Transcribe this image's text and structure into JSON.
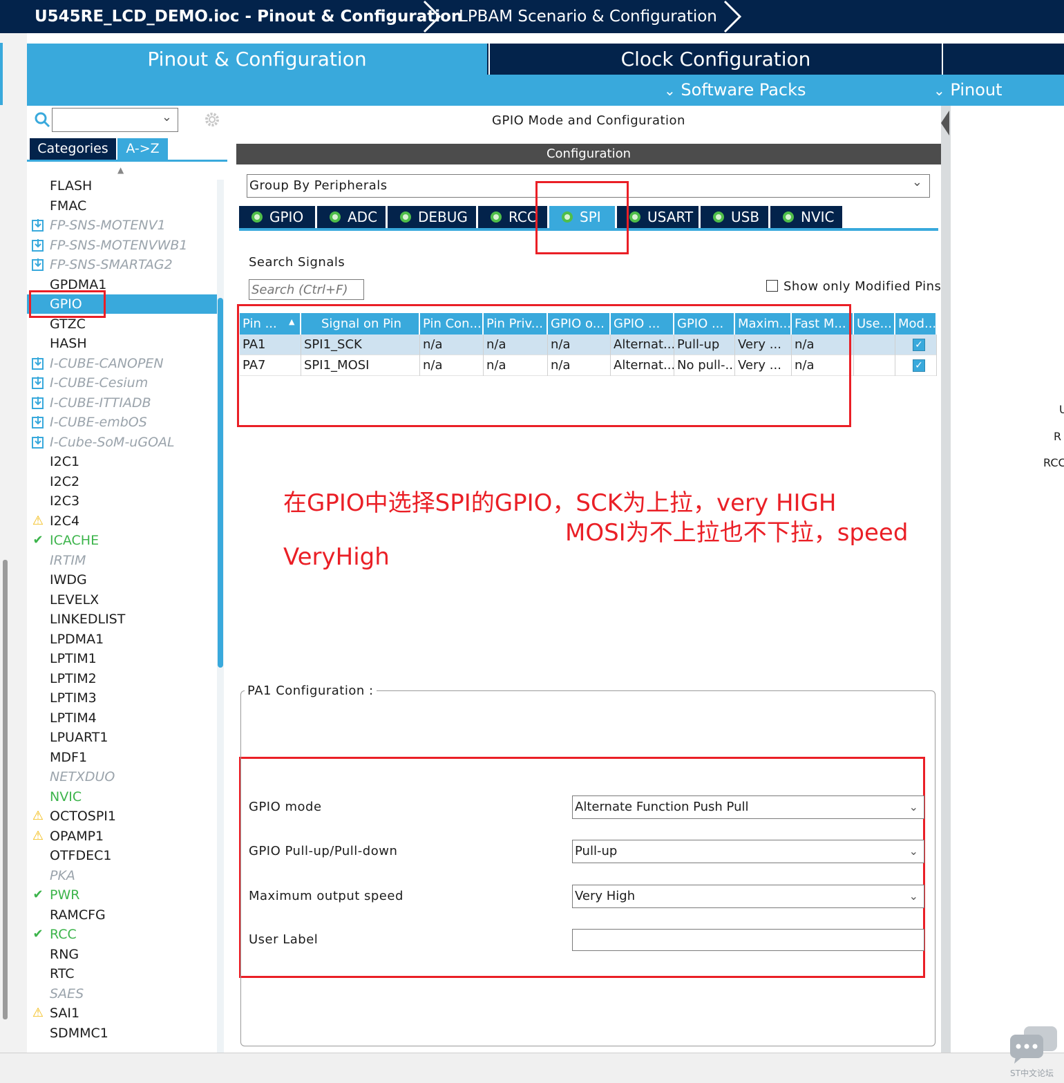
{
  "breadcrumb": {
    "project": "U545RE_LCD_DEMO.ioc - Pinout & Configuration",
    "scenario": "LPBAM Scenario & Configuration"
  },
  "main_tabs": {
    "pinout_config": "Pinout & Configuration",
    "clock_config": "Clock Configuration"
  },
  "sub_menu": {
    "software_packs": "Software Packs",
    "pinout": "Pinout"
  },
  "left": {
    "search_value": "",
    "tab_categories": "Categories",
    "tab_az": "A->Z",
    "items": [
      {
        "label": "FLASH",
        "style": "normal",
        "icon": ""
      },
      {
        "label": "FMAC",
        "style": "normal",
        "icon": ""
      },
      {
        "label": "FP-SNS-MOTENV1",
        "style": "gray",
        "icon": "pack-icon"
      },
      {
        "label": "FP-SNS-MOTENVWB1",
        "style": "gray",
        "icon": "pack-icon"
      },
      {
        "label": "FP-SNS-SMARTAG2",
        "style": "gray",
        "icon": "pack-icon"
      },
      {
        "label": "GPDMA1",
        "style": "normal",
        "icon": ""
      },
      {
        "label": "GPIO",
        "style": "selected",
        "icon": ""
      },
      {
        "label": "GTZC",
        "style": "normal",
        "icon": ""
      },
      {
        "label": "HASH",
        "style": "normal",
        "icon": ""
      },
      {
        "label": "I-CUBE-CANOPEN",
        "style": "gray",
        "icon": "pack-icon"
      },
      {
        "label": "I-CUBE-Cesium",
        "style": "gray",
        "icon": "pack-icon"
      },
      {
        "label": "I-CUBE-ITTIADB",
        "style": "gray",
        "icon": "pack-icon"
      },
      {
        "label": "I-CUBE-embOS",
        "style": "gray",
        "icon": "pack-icon"
      },
      {
        "label": "I-Cube-SoM-uGOAL",
        "style": "gray",
        "icon": "pack-icon"
      },
      {
        "label": "I2C1",
        "style": "normal",
        "icon": ""
      },
      {
        "label": "I2C2",
        "style": "normal",
        "icon": ""
      },
      {
        "label": "I2C3",
        "style": "normal",
        "icon": ""
      },
      {
        "label": "I2C4",
        "style": "normal",
        "icon": "warning-icon"
      },
      {
        "label": "ICACHE",
        "style": "green",
        "icon": "check-icon"
      },
      {
        "label": "IRTIM",
        "style": "gray",
        "icon": ""
      },
      {
        "label": "IWDG",
        "style": "normal",
        "icon": ""
      },
      {
        "label": "LEVELX",
        "style": "normal",
        "icon": ""
      },
      {
        "label": "LINKEDLIST",
        "style": "normal",
        "icon": ""
      },
      {
        "label": "LPDMA1",
        "style": "normal",
        "icon": ""
      },
      {
        "label": "LPTIM1",
        "style": "normal",
        "icon": ""
      },
      {
        "label": "LPTIM2",
        "style": "normal",
        "icon": ""
      },
      {
        "label": "LPTIM3",
        "style": "normal",
        "icon": ""
      },
      {
        "label": "LPTIM4",
        "style": "normal",
        "icon": ""
      },
      {
        "label": "LPUART1",
        "style": "normal",
        "icon": ""
      },
      {
        "label": "MDF1",
        "style": "normal",
        "icon": ""
      },
      {
        "label": "NETXDUO",
        "style": "gray",
        "icon": ""
      },
      {
        "label": "NVIC",
        "style": "green",
        "icon": ""
      },
      {
        "label": "OCTOSPI1",
        "style": "normal",
        "icon": "warning-icon"
      },
      {
        "label": "OPAMP1",
        "style": "normal",
        "icon": "warning-icon"
      },
      {
        "label": "OTFDEC1",
        "style": "normal",
        "icon": ""
      },
      {
        "label": "PKA",
        "style": "gray",
        "icon": ""
      },
      {
        "label": "PWR",
        "style": "green",
        "icon": "check-icon"
      },
      {
        "label": "RAMCFG",
        "style": "normal",
        "icon": ""
      },
      {
        "label": "RCC",
        "style": "green",
        "icon": "check-icon"
      },
      {
        "label": "RNG",
        "style": "normal",
        "icon": ""
      },
      {
        "label": "RTC",
        "style": "normal",
        "icon": ""
      },
      {
        "label": "SAES",
        "style": "gray",
        "icon": ""
      },
      {
        "label": "SAI1",
        "style": "normal",
        "icon": "warning-icon"
      },
      {
        "label": "SDMMC1",
        "style": "normal",
        "icon": ""
      }
    ]
  },
  "middle": {
    "panel_title": "GPIO Mode and Configuration",
    "config_header": "Configuration",
    "group_by": "Group By Peripherals",
    "peripheral_tabs": [
      "GPIO",
      "ADC",
      "DEBUG",
      "RCC",
      "SPI",
      "USART",
      "USB",
      "NVIC"
    ],
    "search_signals_label": "Search Signals",
    "search_placeholder": "Search (Ctrl+F)",
    "show_modified_label": "Show only Modified Pins",
    "table": {
      "headers": [
        "Pin ...",
        "Signal on Pin",
        "Pin Con...",
        "Pin Priv...",
        "GPIO o...",
        "GPIO ...",
        "GPIO ...",
        "Maxim...",
        "Fast M...",
        "Use...",
        "Mod..."
      ],
      "rows": [
        [
          "PA1",
          "SPI1_SCK",
          "n/a",
          "n/a",
          "n/a",
          "Alternat...",
          "Pull-up",
          "Very ...",
          "n/a",
          "",
          true
        ],
        [
          "PA7",
          "SPI1_MOSI",
          "n/a",
          "n/a",
          "n/a",
          "Alternat...",
          "No pull-...",
          "Very ...",
          "n/a",
          "",
          true
        ]
      ]
    },
    "annotation": {
      "line1": "在GPIO中选择SPI的GPIO，SCK为上拉，very HIGH",
      "line2": "MOSI为不上拉也不下拉，speed",
      "line3": "VeryHigh"
    },
    "pa1_config": {
      "title": "PA1 Configuration :",
      "gpio_mode_label": "GPIO mode",
      "gpio_mode_value": "Alternate Function Push Pull",
      "pull_label": "GPIO Pull-up/Pull-down",
      "pull_value": "Pull-up",
      "speed_label": "Maximum output speed",
      "speed_value": "Very High",
      "user_label_label": "User Label",
      "user_label_value": ""
    }
  },
  "right_edge": {
    "labels": [
      "U",
      "R",
      "RCC"
    ]
  },
  "watermark": {
    "text": "ST中文论坛"
  },
  "colors": {
    "navy": "#03234b",
    "accent": "#39a9dc",
    "red": "#ea1f26",
    "green": "#3cb44b"
  }
}
